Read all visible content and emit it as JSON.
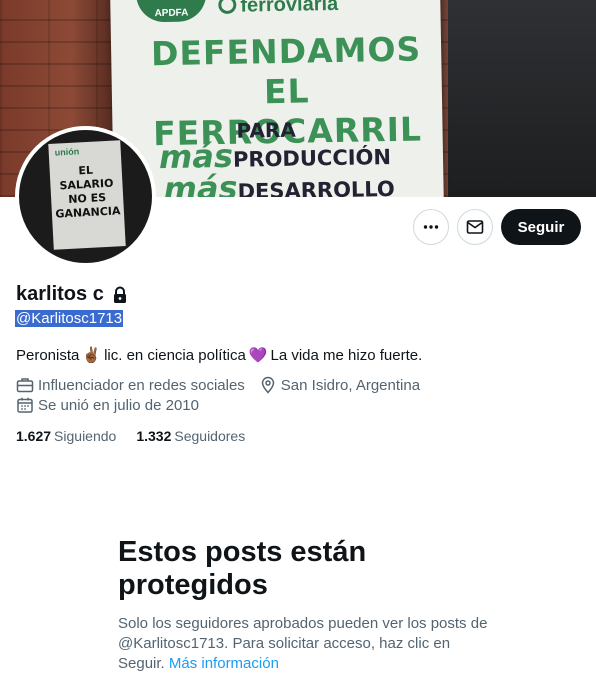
{
  "banner": {
    "poster_logo": "APDFA",
    "poster_brand": "ferroviaria",
    "poster_headline_1": "DEFENDAMOS",
    "poster_headline_2": "EL FERROCARRIL",
    "poster_line_para": "PARA",
    "poster_line_prod_prefix": "más",
    "poster_line_prod": "PRODUCCIÓN",
    "poster_line_des_prefix": "más",
    "poster_line_des": "DESARROLLO"
  },
  "avatar": {
    "sign_top": "unión",
    "sign_lines": "EL SALARIO NO ES GANANCIA"
  },
  "actions": {
    "follow_label": "Seguir"
  },
  "profile": {
    "name": "karlitos c",
    "handle": "@Karlitosc1713",
    "bio_part1": "Peronista",
    "bio_emoji1": "✌🏾",
    "bio_part2": "lic.  en ciencia política",
    "bio_emoji2": "💜",
    "bio_part3": "La vida me hizo fuerte.",
    "category": "Influenciador en redes sociales",
    "location": "San Isidro, Argentina",
    "joined": "Se unió en julio de 2010",
    "following_count": "1.627",
    "following_label": "Siguiendo",
    "followers_count": "1.332",
    "followers_label": "Seguidores"
  },
  "protected": {
    "title": "Estos posts están protegidos",
    "text": "Solo los seguidores aprobados pueden ver los posts de @Karlitosc1713. Para solicitar acceso, haz clic en Seguir.",
    "link": "Más información"
  },
  "colors": {
    "accent": "#1d9bf0",
    "text_primary": "#0f1419",
    "text_secondary": "#536471",
    "follow_button": "#0f1419",
    "selection": "#3a6bd0"
  },
  "icons": [
    "more-icon",
    "mail-icon",
    "lock-icon",
    "briefcase-icon",
    "location-pin-icon",
    "calendar-icon"
  ]
}
